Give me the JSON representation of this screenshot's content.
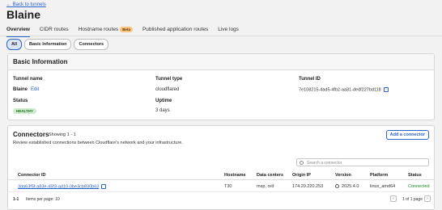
{
  "nav": {
    "back_label": "← Back to tunnels"
  },
  "page": {
    "title": "Blaine"
  },
  "tabs": [
    {
      "label": "Overview"
    },
    {
      "label": "CIDR routes"
    },
    {
      "label": "Hostname routes",
      "badge": "Beta"
    },
    {
      "label": "Published application routes"
    },
    {
      "label": "Live logs"
    }
  ],
  "filters": [
    "All",
    "Basic Information",
    "Connectors"
  ],
  "basic_info": {
    "heading": "Basic Information",
    "tunnel_name_label": "Tunnel name",
    "tunnel_name": "Blaine",
    "edit_label": "Edit",
    "tunnel_type_label": "Tunnel type",
    "tunnel_type": "cloudflared",
    "tunnel_id_label": "Tunnel ID",
    "tunnel_id": "7e108215-4ad5-4fb2-aa31-dedf227bd118",
    "status_label": "Status",
    "status": "HEALTHY",
    "uptime_label": "Uptime",
    "uptime": "3 days"
  },
  "connectors": {
    "heading": "Connectors",
    "count_text": "Showing 1 - 1",
    "description": "Review established connections between Cloudflare's network and your infrastructure.",
    "add_button": "Add a connector",
    "search_placeholder": "Search a connector",
    "columns": [
      "Connector ID",
      "Hostname",
      "Data centers",
      "Origin IP",
      "Version",
      "Platform",
      "Status"
    ],
    "rows": [
      {
        "id": "3da63f5f-a83e-45f3-ad10-0be3cb830b63",
        "hostname": "T30",
        "data_centers": "msp, ord",
        "origin_ip": "174.20.220.253",
        "version": "2025.4.0",
        "platform": "linux_amd64",
        "status": "Connected"
      }
    ],
    "pager": {
      "range": "1-1",
      "per_page": "Items per page: 10",
      "page_of": "1 of 1 page"
    }
  },
  "colors": {
    "accent": "#2c63c9",
    "healthy_bg": "#cfeccf",
    "connected": "#1d8a1d",
    "beta": "#f7c37e"
  }
}
